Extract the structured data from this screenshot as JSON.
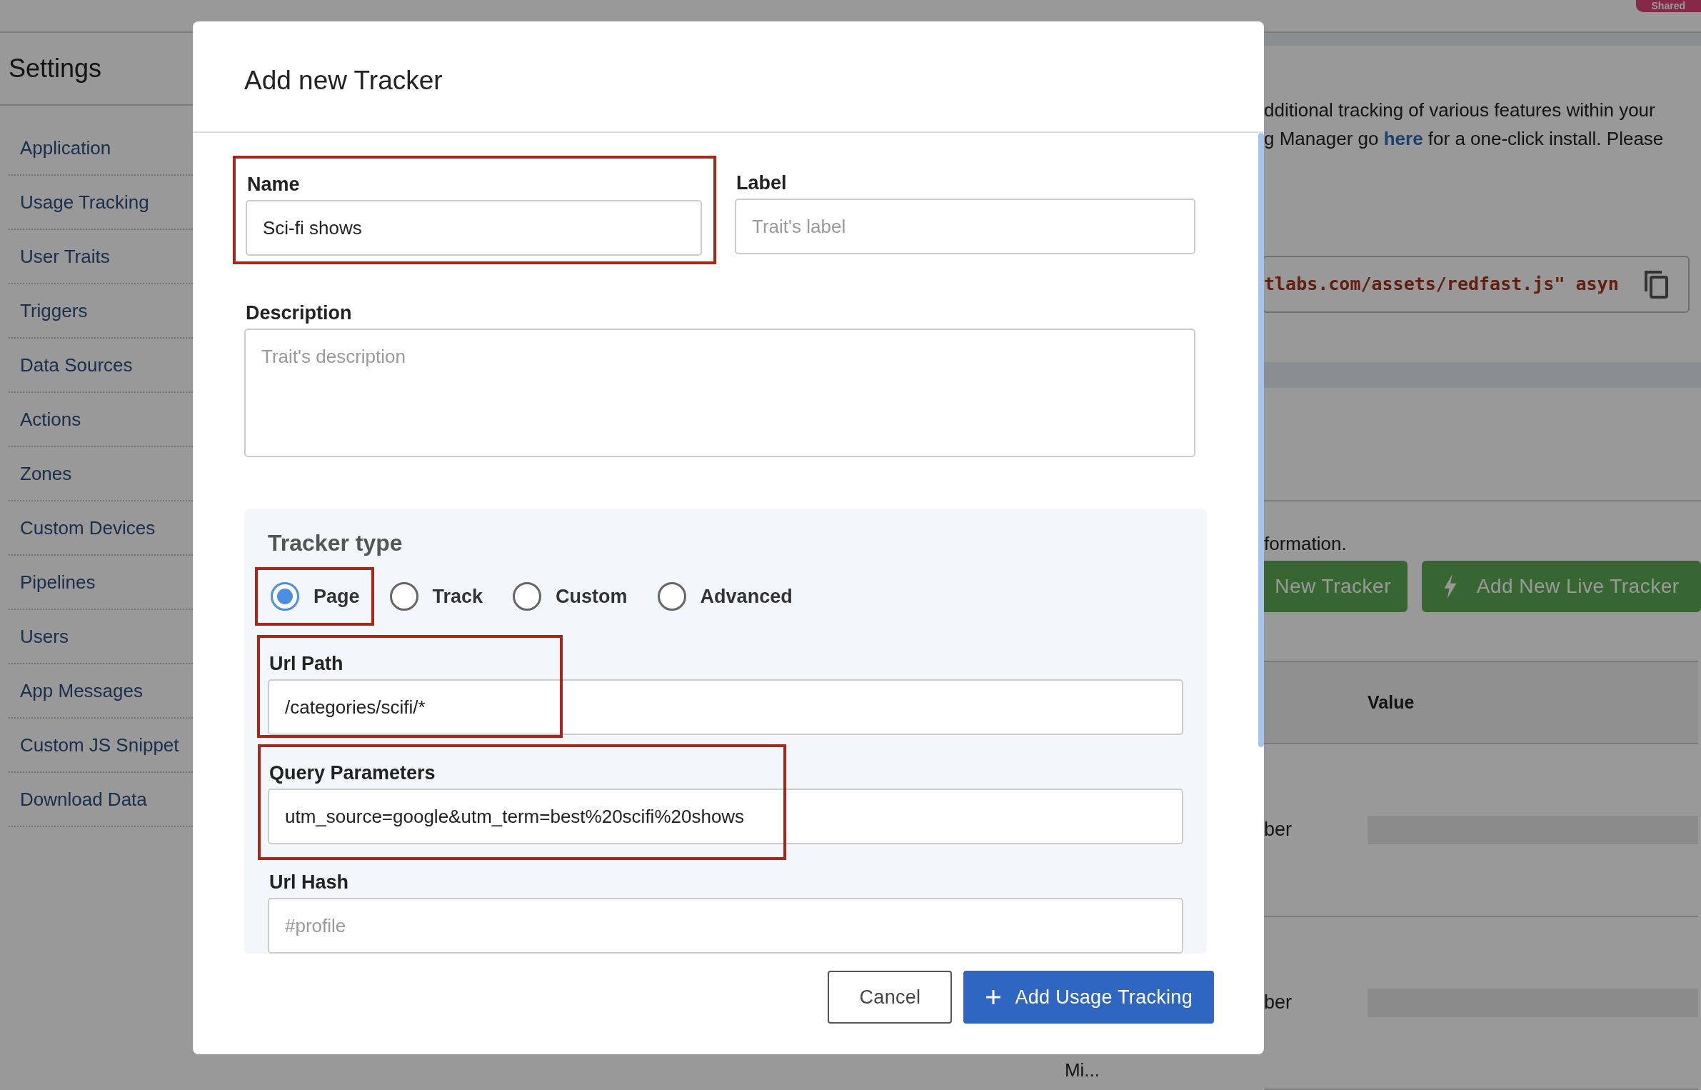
{
  "top_bar": {
    "badge": "Shared"
  },
  "sidebar": {
    "title": "Settings",
    "items": [
      {
        "label": "Application"
      },
      {
        "label": "Usage Tracking"
      },
      {
        "label": "User Traits"
      },
      {
        "label": "Triggers"
      },
      {
        "label": "Data Sources"
      },
      {
        "label": "Actions"
      },
      {
        "label": "Zones"
      },
      {
        "label": "Custom Devices"
      },
      {
        "label": "Pipelines"
      },
      {
        "label": "Users"
      },
      {
        "label": "App Messages"
      },
      {
        "label": "Custom JS Snippet"
      },
      {
        "label": "Download Data"
      }
    ]
  },
  "intro": {
    "line_1": "dditional tracking of various features within your",
    "line_2_before": "g Manager go ",
    "line_2_link": "here",
    "line_2_after": " for a one-click install. Please"
  },
  "snippet": "tlabs.com/assets/redfast.js\" asyn",
  "info_text": "formation.",
  "tracker_buttons": [
    {
      "label": "New Tracker",
      "kind": "plain"
    },
    {
      "label": "Add New Live Tracker",
      "kind": "live"
    }
  ],
  "table": {
    "columns": [
      {
        "label": "Value"
      }
    ],
    "rows": [
      {
        "cell": "ber"
      },
      {
        "cell": "ber"
      }
    ]
  },
  "footer_text": "Mi...",
  "modal": {
    "title": "Add new Tracker",
    "fields": [
      {
        "label": "Name",
        "kind": "text",
        "value": "Sci-fi shows",
        "highlighted": true
      },
      {
        "label": "Label",
        "kind": "text",
        "placeholder": "Trait's label",
        "highlighted": false
      },
      {
        "label": "Description",
        "kind": "textarea",
        "placeholder": "Trait's description",
        "highlighted": false
      }
    ],
    "tracker_type": {
      "title": "Tracker type",
      "options": [
        {
          "label": "Page",
          "selected": true,
          "highlighted": true
        },
        {
          "label": "Track",
          "selected": false,
          "highlighted": false
        },
        {
          "label": "Custom",
          "selected": false,
          "highlighted": false
        },
        {
          "label": "Advanced",
          "selected": false,
          "highlighted": false
        }
      ],
      "fields": [
        {
          "label": "Url Path",
          "value": "/categories/scifi/*",
          "highlighted": true
        },
        {
          "label": "Query Parameters",
          "value": "utm_source=google&utm_term=best%20scifi%20shows",
          "highlighted": true
        },
        {
          "label": "Url Hash",
          "placeholder": "#profile",
          "highlighted": false
        }
      ]
    },
    "buttons": [
      {
        "label": "Cancel",
        "kind": "secondary"
      },
      {
        "label": "Add Usage Tracking",
        "kind": "primary"
      }
    ]
  }
}
